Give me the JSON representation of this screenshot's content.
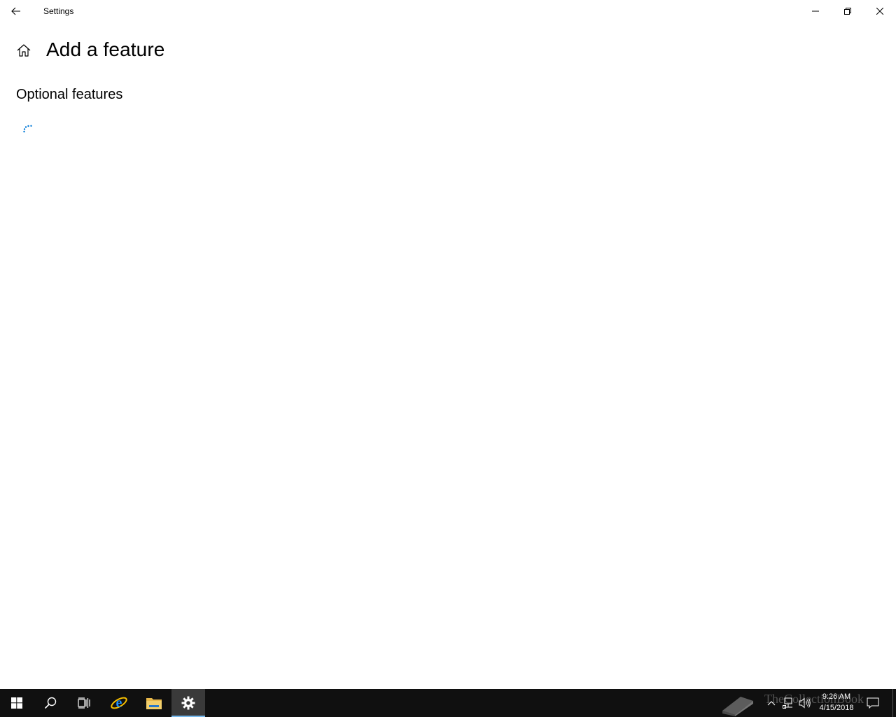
{
  "window": {
    "title": "Settings"
  },
  "page": {
    "title": "Add a feature",
    "section_title": "Optional features"
  },
  "taskbar": {
    "items": [
      {
        "name": "start-button",
        "icon": "windows-logo-icon"
      },
      {
        "name": "search-button",
        "icon": "search-icon"
      },
      {
        "name": "task-view-button",
        "icon": "task-view-icon"
      },
      {
        "name": "internet-explorer-button",
        "icon": "internet-explorer-icon"
      },
      {
        "name": "file-explorer-button",
        "icon": "folder-icon"
      },
      {
        "name": "settings-button",
        "icon": "gear-icon",
        "active": true
      }
    ],
    "clock": {
      "time": "9:26 AM",
      "date": "4/15/2018"
    },
    "watermark": "TheCollectionBook"
  },
  "colors": {
    "accent": "#0078d7",
    "taskbar_bg": "#101010",
    "active_indicator": "#76b9ed"
  }
}
